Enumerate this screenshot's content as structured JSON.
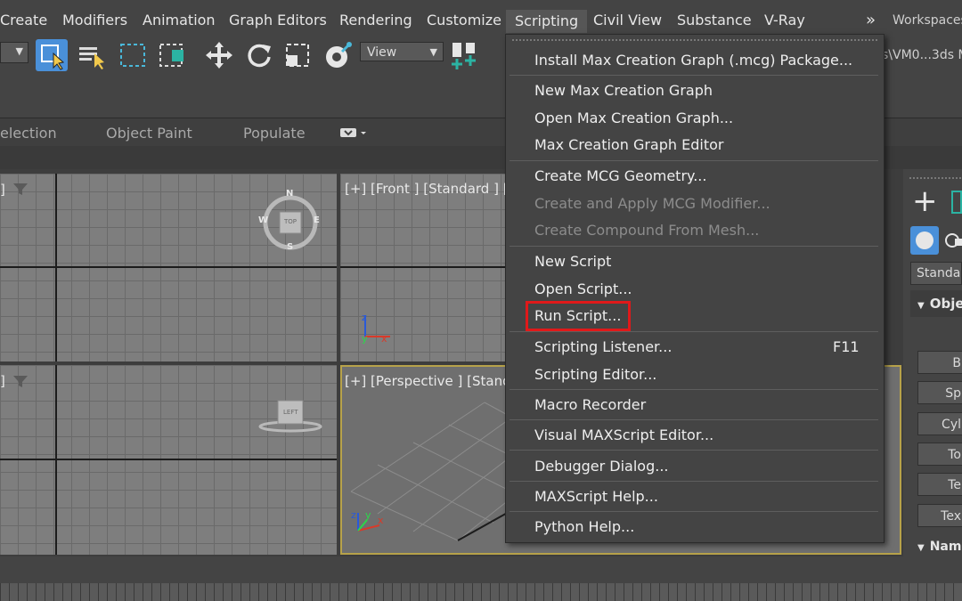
{
  "menubar": {
    "items": [
      "Create",
      "Modifiers",
      "Animation",
      "Graph Editors",
      "Rendering",
      "Customize",
      "Scripting",
      "Civil View",
      "Substance",
      "V-Ray"
    ],
    "chevron": "»",
    "workspaces": "Workspaces"
  },
  "toolbar": {
    "view_label": "View",
    "path_text": "s\\VM0...3ds M"
  },
  "ribbon": {
    "tabs": [
      "election",
      "Object Paint",
      "Populate"
    ]
  },
  "viewports": {
    "front_label": "[+] [Front ] [Standard ] [",
    "persp_label": "[+] [Perspective ] [Stand",
    "top_right_bracket": "]",
    "left_bracket": "]",
    "compass": {
      "n": "N",
      "s": "S",
      "e": "E",
      "w": "W",
      "cube": "TOP"
    },
    "left_cube": "LEFT"
  },
  "cmdpanel": {
    "dropdown": "Standar",
    "rollout": "Obje",
    "buttons": [
      "B",
      "Sp",
      "Cyl",
      "To",
      "Te",
      "Tex"
    ],
    "name_rollout": "Nam"
  },
  "menu": {
    "items": [
      {
        "label": "Install Max Creation Graph (.mcg) Package...",
        "disabled": false
      },
      {
        "label": "New Max Creation Graph",
        "disabled": false
      },
      {
        "label": "Open Max Creation Graph...",
        "disabled": false
      },
      {
        "label": "Max Creation Graph Editor",
        "disabled": false
      },
      {
        "label": "Create MCG Geometry...",
        "disabled": false
      },
      {
        "label": "Create and Apply MCG Modifier...",
        "disabled": true
      },
      {
        "label": "Create Compound From Mesh...",
        "disabled": true
      },
      {
        "label": "New Script",
        "disabled": false
      },
      {
        "label": "Open Script...",
        "disabled": false
      },
      {
        "label": "Run Script...",
        "disabled": false
      },
      {
        "label": "Scripting Listener...",
        "disabled": false,
        "shortcut": "F11"
      },
      {
        "label": "Scripting Editor...",
        "disabled": false
      },
      {
        "label": "Macro Recorder",
        "disabled": false
      },
      {
        "label": "Visual MAXScript Editor...",
        "disabled": false
      },
      {
        "label": "Debugger Dialog...",
        "disabled": false
      },
      {
        "label": "MAXScript Help...",
        "disabled": false
      },
      {
        "label": "Python Help...",
        "disabled": false
      }
    ]
  },
  "colors": {
    "highlight": "#e0191a",
    "active_viewport_border": "#b7a24a",
    "selection_blue": "#4a90d9"
  }
}
